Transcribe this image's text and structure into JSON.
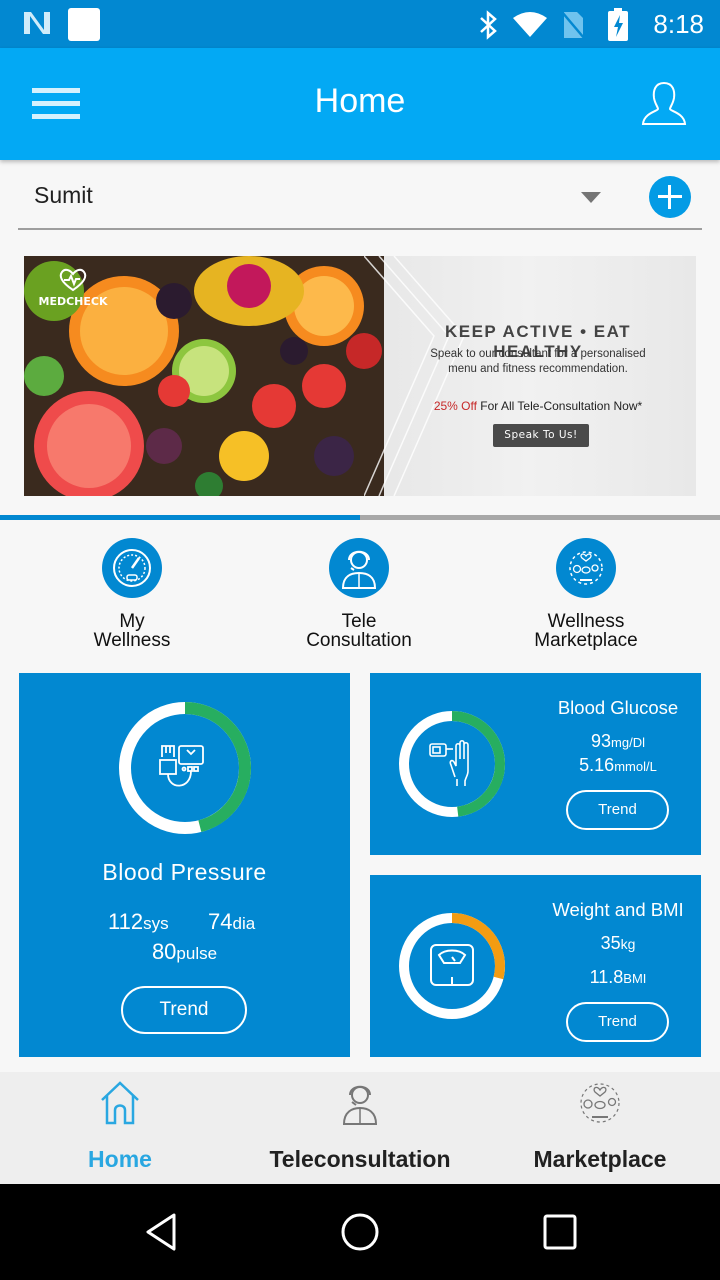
{
  "status_bar": {
    "time": "8:18",
    "icons": [
      "notification-n-icon",
      "notification-square-icon",
      "bluetooth-icon",
      "wifi-icon",
      "no-sim-icon",
      "battery-charging-icon"
    ]
  },
  "app_bar": {
    "title": "Home",
    "menu_icon": "hamburger-menu-icon",
    "profile_icon": "profile-icon"
  },
  "profile_selector": {
    "selected": "Sumit",
    "add_icon": "plus-circle-icon"
  },
  "banner": {
    "logo_text": "MEDCHECK",
    "headline": "KEEP ACTIVE • EAT HEALTHY",
    "subtext_line1": "Speak to our consultant for a personalised",
    "subtext_line2": "menu and fitness recommendation.",
    "offer_highlight": "25% Off",
    "offer_rest": " For All Tele-Consultation Now*",
    "cta": "Speak To Us!",
    "carousel_progress": 0.5,
    "colors": {
      "offer": "#c62828"
    }
  },
  "quick_actions": [
    {
      "line1": "My",
      "line2": "Wellness",
      "icon": "speedometer-icon"
    },
    {
      "line1": "Tele",
      "line2": "Consultation",
      "icon": "doctor-headset-icon"
    },
    {
      "line1": "Wellness",
      "line2": "Marketplace",
      "icon": "wellness-cycle-icon"
    }
  ],
  "tiles": {
    "blood_pressure": {
      "title": "Blood Pressure",
      "sys_value": "112",
      "sys_unit": "sys",
      "dia_value": "74",
      "dia_unit": "dia",
      "pulse_value": "80",
      "pulse_unit": "pulse",
      "trend": "Trend",
      "ring_fraction": 0.46,
      "ring_color": "#27ae60"
    },
    "blood_glucose": {
      "title": "Blood Glucose",
      "mg_value": "93",
      "mg_unit": "mg/Dl",
      "mmol_value": "5.16",
      "mmol_unit": "mmol/L",
      "trend": "Trend",
      "ring_fraction": 0.48,
      "ring_color": "#27ae60"
    },
    "weight_bmi": {
      "title": "Weight and BMI",
      "weight_value": "35",
      "weight_unit": "kg",
      "bmi_value": "11.8",
      "bmi_unit": "BMI",
      "trend": "Trend",
      "ring_fraction": 0.29,
      "ring_color": "#f39c12"
    }
  },
  "bottom_nav": {
    "items": [
      {
        "label": "Home",
        "icon": "home-icon",
        "active": true
      },
      {
        "label": "Teleconsultation",
        "icon": "doctor-headset-icon",
        "active": false
      },
      {
        "label": "Marketplace",
        "icon": "wellness-cycle-icon",
        "active": false
      }
    ],
    "active_color": "#29a7e1"
  },
  "system_nav": {
    "icons": [
      "back-icon",
      "home-circle-icon",
      "recents-icon"
    ]
  }
}
